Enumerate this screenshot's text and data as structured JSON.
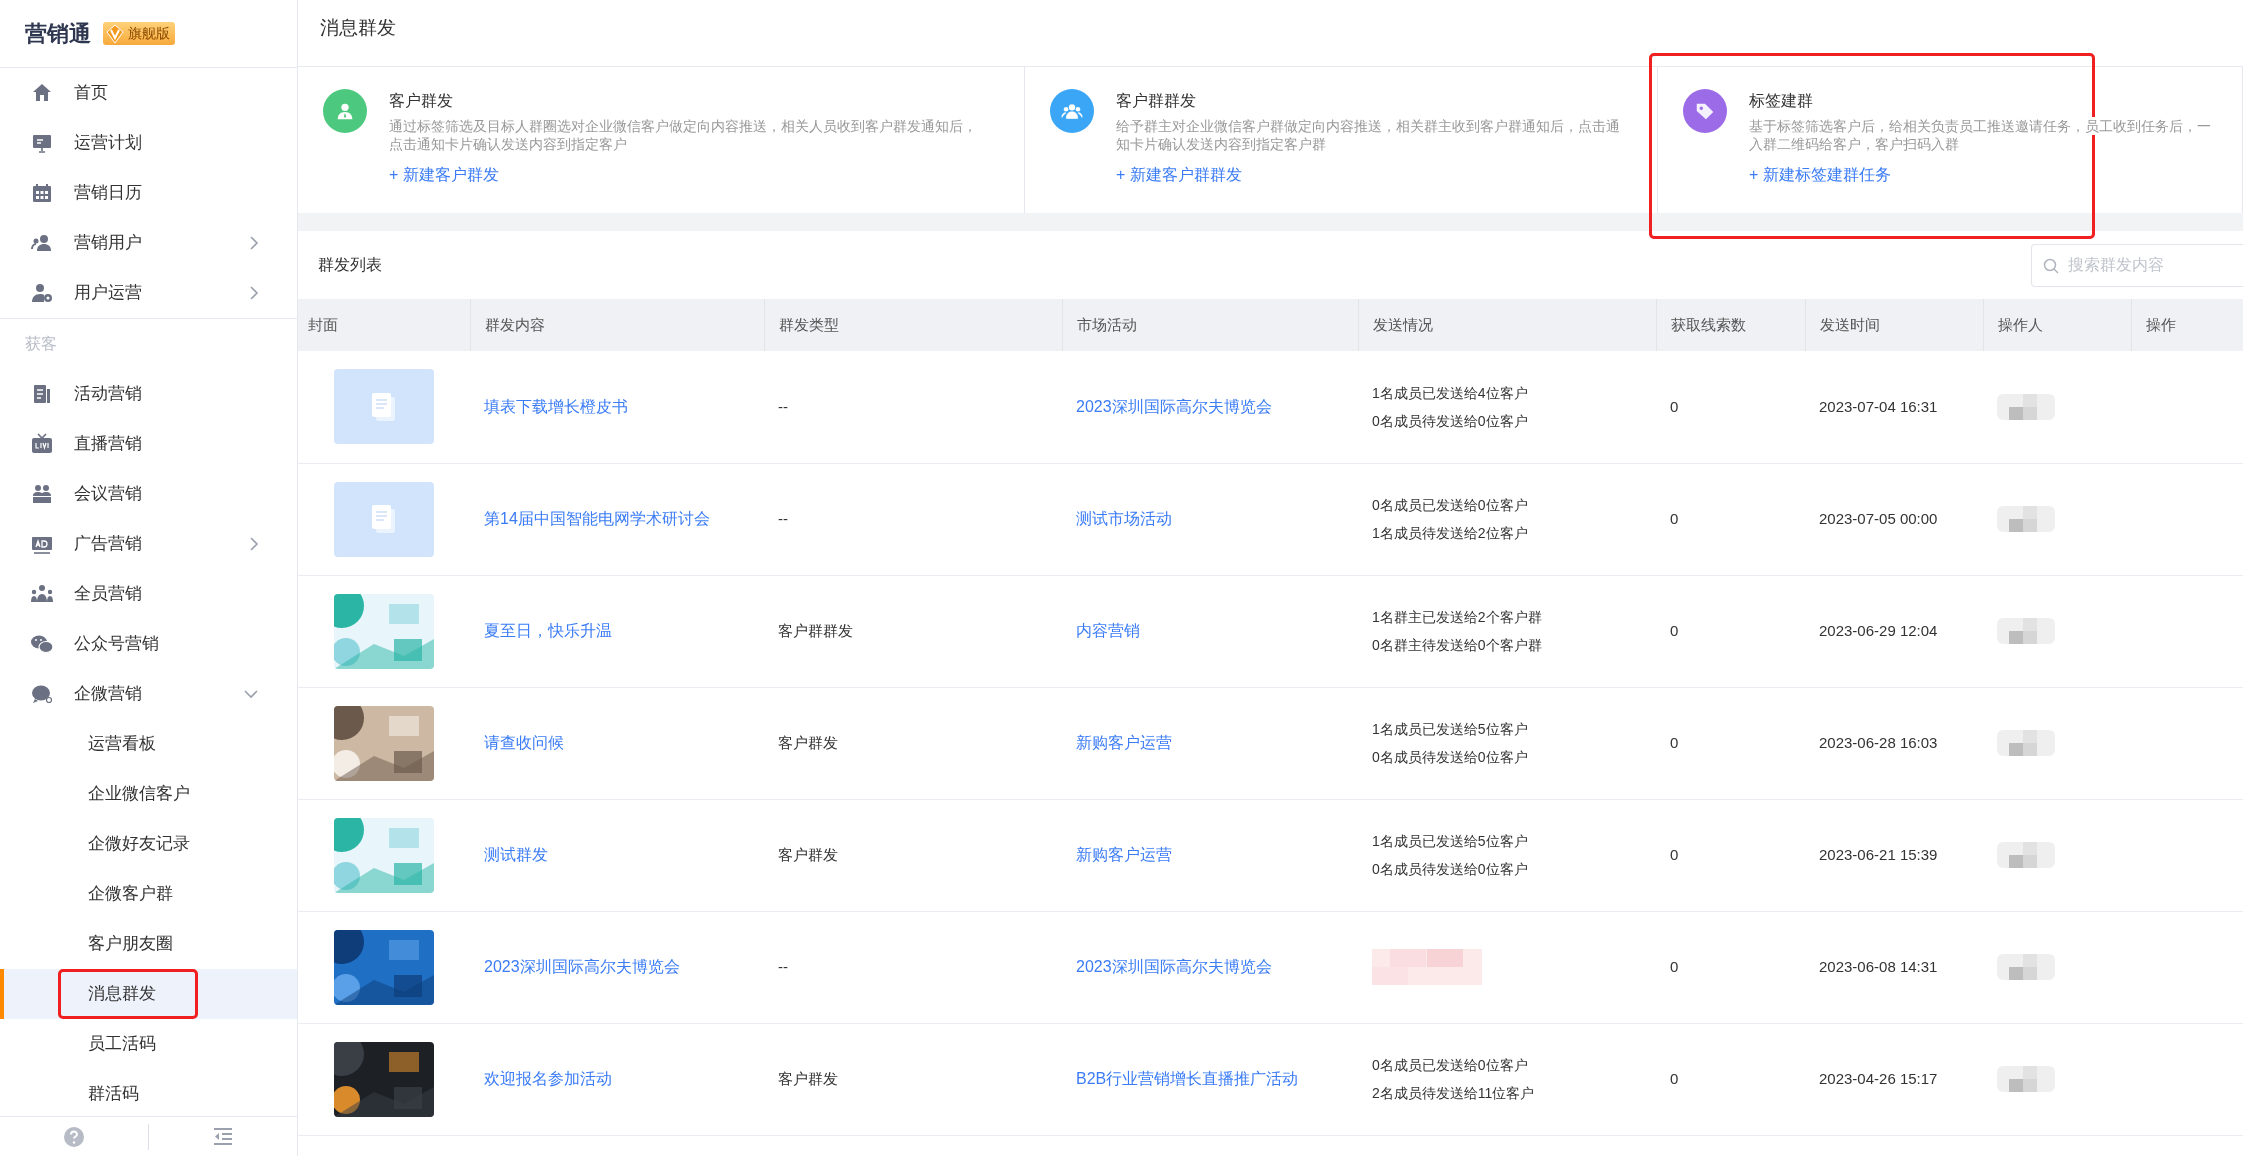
{
  "brand": {
    "name": "营销通",
    "edition": "旗舰版"
  },
  "sidebar": {
    "sections": [
      {
        "items": [
          {
            "label": "首页"
          },
          {
            "label": "运营计划"
          },
          {
            "label": "营销日历"
          },
          {
            "label": "营销用户",
            "expanded": false
          },
          {
            "label": "用户运营",
            "expanded": false
          }
        ]
      },
      {
        "label": "获客",
        "items": [
          {
            "label": "活动营销"
          },
          {
            "label": "直播营销"
          },
          {
            "label": "会议营销"
          },
          {
            "label": "广告营销",
            "expanded": false
          },
          {
            "label": "全员营销"
          },
          {
            "label": "公众号营销"
          },
          {
            "label": "企微营销",
            "expanded": true,
            "children": [
              {
                "label": "运营看板",
                "selected": false,
                "highlighted": false
              },
              {
                "label": "企业微信客户",
                "selected": false,
                "highlighted": false
              },
              {
                "label": "企微好友记录",
                "selected": false,
                "highlighted": false
              },
              {
                "label": "企微客户群",
                "selected": false,
                "highlighted": false
              },
              {
                "label": "客户朋友圈",
                "selected": false,
                "highlighted": false
              },
              {
                "label": "消息群发",
                "selected": true,
                "highlighted": true
              },
              {
                "label": "员工活码",
                "selected": false,
                "highlighted": false
              },
              {
                "label": "群活码",
                "selected": false,
                "highlighted": false
              }
            ]
          }
        ]
      }
    ]
  },
  "page_title": "消息群发",
  "cards": [
    {
      "title": "客户群发",
      "color": "#4cc97e",
      "highlighted": false,
      "description": [
        "通过标签筛选及目标人群圈选对企业微信客户做定向内容推送，相关人员收到客户群发通知后，",
        "点击通知卡片确认发送内容到指定客户"
      ],
      "action": "+ 新建客户群发"
    },
    {
      "title": "客户群群发",
      "color": "#3aa6f5",
      "highlighted": false,
      "description": [
        "给予群主对企业微信客户群做定向内容推送，相关群主收到客户群通知后，点击通",
        "知卡片确认发送内容到指定客户群"
      ],
      "action": "+ 新建客户群群发"
    },
    {
      "title": "标签建群",
      "color": "#9b6be8",
      "highlighted": true,
      "description": [
        "基于标签筛选客户后，给相关负责员工推送邀请任务，员工收到任务后，一",
        "入群二维码给客户，客户扫码入群"
      ],
      "action": "+ 新建标签建群任务"
    }
  ],
  "list": {
    "title": "群发列表",
    "search": {
      "placeholder": "搜索群发内容"
    },
    "columns": [
      "封面",
      "群发内容",
      "群发类型",
      "市场活动",
      "发送情况",
      "获取线索数",
      "发送时间",
      "操作人",
      "操作"
    ],
    "rows": [
      {
        "kind": "placeholder",
        "content": "填表下载增长橙皮书",
        "type": "--",
        "campaign": "2023深圳国际高尔夫博览会",
        "status_blurred": false,
        "status": [
          "1名成员已发送给4位客户",
          "0名成员待发送给0位客户"
        ],
        "leads": "0",
        "time": "2023-07-04 16:31"
      },
      {
        "kind": "placeholder",
        "content": "第14届中国智能电网学术研讨会",
        "type": "--",
        "campaign": "测试市场活动",
        "status_blurred": false,
        "status": [
          "0名成员已发送给0位客户",
          "1名成员待发送给2位客户"
        ],
        "leads": "0",
        "time": "2023-07-05 00:00"
      },
      {
        "kind": "picture",
        "content": "夏至日，快乐升温",
        "type": "客户群群发",
        "campaign": "内容营销",
        "status_blurred": false,
        "status": [
          "1名群主已发送给2个客户群",
          "0名群主待发送给0个客户群"
        ],
        "leads": "0",
        "time": "2023-06-29 12:04"
      },
      {
        "kind": "picture",
        "content": "请查收问候",
        "type": "客户群发",
        "campaign": "新购客户运营",
        "status_blurred": false,
        "status": [
          "1名成员已发送给5位客户",
          "0名成员待发送给0位客户"
        ],
        "leads": "0",
        "time": "2023-06-28 16:03"
      },
      {
        "kind": "picture",
        "content": "测试群发",
        "type": "客户群发",
        "campaign": "新购客户运营",
        "status_blurred": false,
        "status": [
          "1名成员已发送给5位客户",
          "0名成员待发送给0位客户"
        ],
        "leads": "0",
        "time": "2023-06-21 15:39"
      },
      {
        "kind": "picture",
        "content": "2023深圳国际高尔夫博览会",
        "type": "--",
        "campaign": "2023深圳国际高尔夫博览会",
        "status_blurred": true,
        "leads": "0",
        "time": "2023-06-08 14:31"
      },
      {
        "kind": "picture",
        "content": "欢迎报名参加活动",
        "type": "客户群发",
        "campaign": "B2B行业营销增长直播推广活动",
        "status_blurred": false,
        "status": [
          "0名成员已发送给0位客户",
          "2名成员待发送给11位客户"
        ],
        "leads": "0",
        "time": "2023-04-26 15:17"
      }
    ]
  }
}
